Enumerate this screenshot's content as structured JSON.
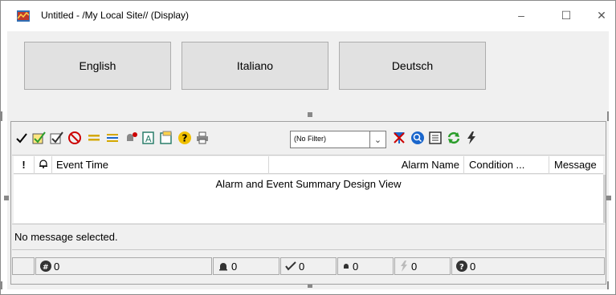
{
  "window": {
    "title": "Untitled - /My Local Site// (Display)",
    "minimize_glyph": "–",
    "maximize_glyph": "☐",
    "close_glyph": "✕"
  },
  "language_buttons": [
    {
      "label": "English"
    },
    {
      "label": "Italiano"
    },
    {
      "label": "Deutsch"
    }
  ],
  "toolbar": {
    "icons": [
      "acknowledge-icon",
      "ack-selected-icon",
      "ack-all-icon",
      "no-entry-icon",
      "filter-equal-icon",
      "filter-list-icon",
      "alarm-bell-icon",
      "add-to-list-icon",
      "properties-icon",
      "help-icon",
      "print-icon"
    ],
    "filter_value": "(No Filter)",
    "icons_after": [
      "clear-filter-icon",
      "search-icon",
      "details-icon",
      "refresh-icon",
      "lightning-icon"
    ]
  },
  "grid": {
    "columns": [
      "!",
      "bell",
      "Event Time",
      "Alarm Name",
      "Condition ...",
      "Message"
    ],
    "design_view_text": "Alarm and Event Summary Design View"
  },
  "message_bar": {
    "text": "No message selected."
  },
  "status_bar": {
    "total": "0",
    "alarms": "0",
    "acknowledged": "0",
    "unack": "0",
    "events": "0",
    "unknown": "0"
  },
  "colors": {
    "title_bg": "#ffffff",
    "client_bg": "#f0f0f0",
    "button_bg": "#e1e1e1",
    "accent_red": "#cc0000",
    "accent_blue": "#1a66cc",
    "accent_green": "#2a9d2a",
    "accent_yellow": "#f0c000"
  }
}
